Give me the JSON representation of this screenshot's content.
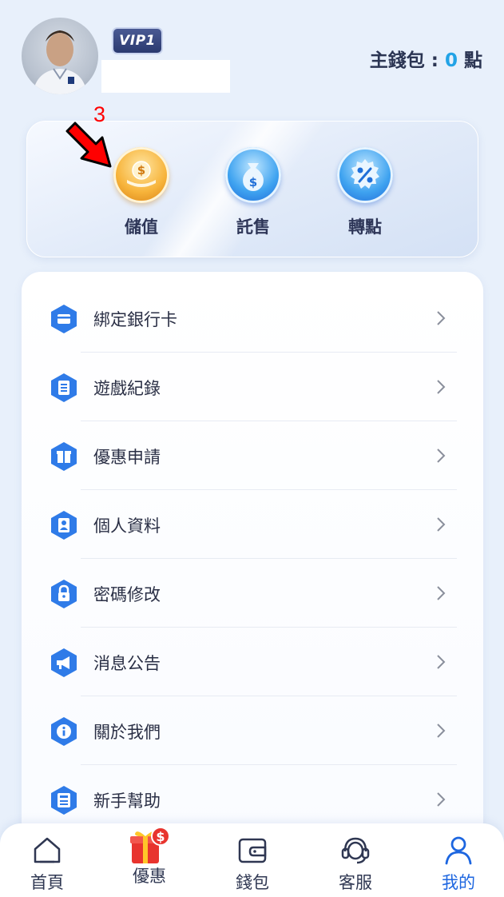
{
  "header": {
    "vip_level": "VIP1",
    "wallet_label": "主錢包 : ",
    "wallet_amount": "0",
    "wallet_unit": " 點"
  },
  "annotation": {
    "step_number": "3"
  },
  "actions": [
    {
      "label": "儲值",
      "icon": "coin-deposit-icon"
    },
    {
      "label": "託售",
      "icon": "money-bag-icon"
    },
    {
      "label": "轉點",
      "icon": "percent-badge-icon"
    }
  ],
  "menu": [
    {
      "label": "綁定銀行卡",
      "icon": "bank-card-icon"
    },
    {
      "label": "遊戲紀錄",
      "icon": "record-list-icon"
    },
    {
      "label": "優惠申請",
      "icon": "gift-icon"
    },
    {
      "label": "個人資料",
      "icon": "profile-card-icon"
    },
    {
      "label": "密碼修改",
      "icon": "lock-icon"
    },
    {
      "label": "消息公告",
      "icon": "megaphone-icon"
    },
    {
      "label": "關於我們",
      "icon": "info-icon"
    },
    {
      "label": "新手幫助",
      "icon": "help-book-icon"
    }
  ],
  "bottom_nav": [
    {
      "label": "首頁",
      "icon": "home-icon"
    },
    {
      "label": "優惠",
      "icon": "gift-box-icon",
      "badge": "$"
    },
    {
      "label": "錢包",
      "icon": "wallet-icon"
    },
    {
      "label": "客服",
      "icon": "headset-icon"
    },
    {
      "label": "我的",
      "icon": "user-icon",
      "active": true
    }
  ],
  "colors": {
    "accent": "#1d66e0",
    "amount": "#22a3e6",
    "annotation": "#ff0000"
  }
}
